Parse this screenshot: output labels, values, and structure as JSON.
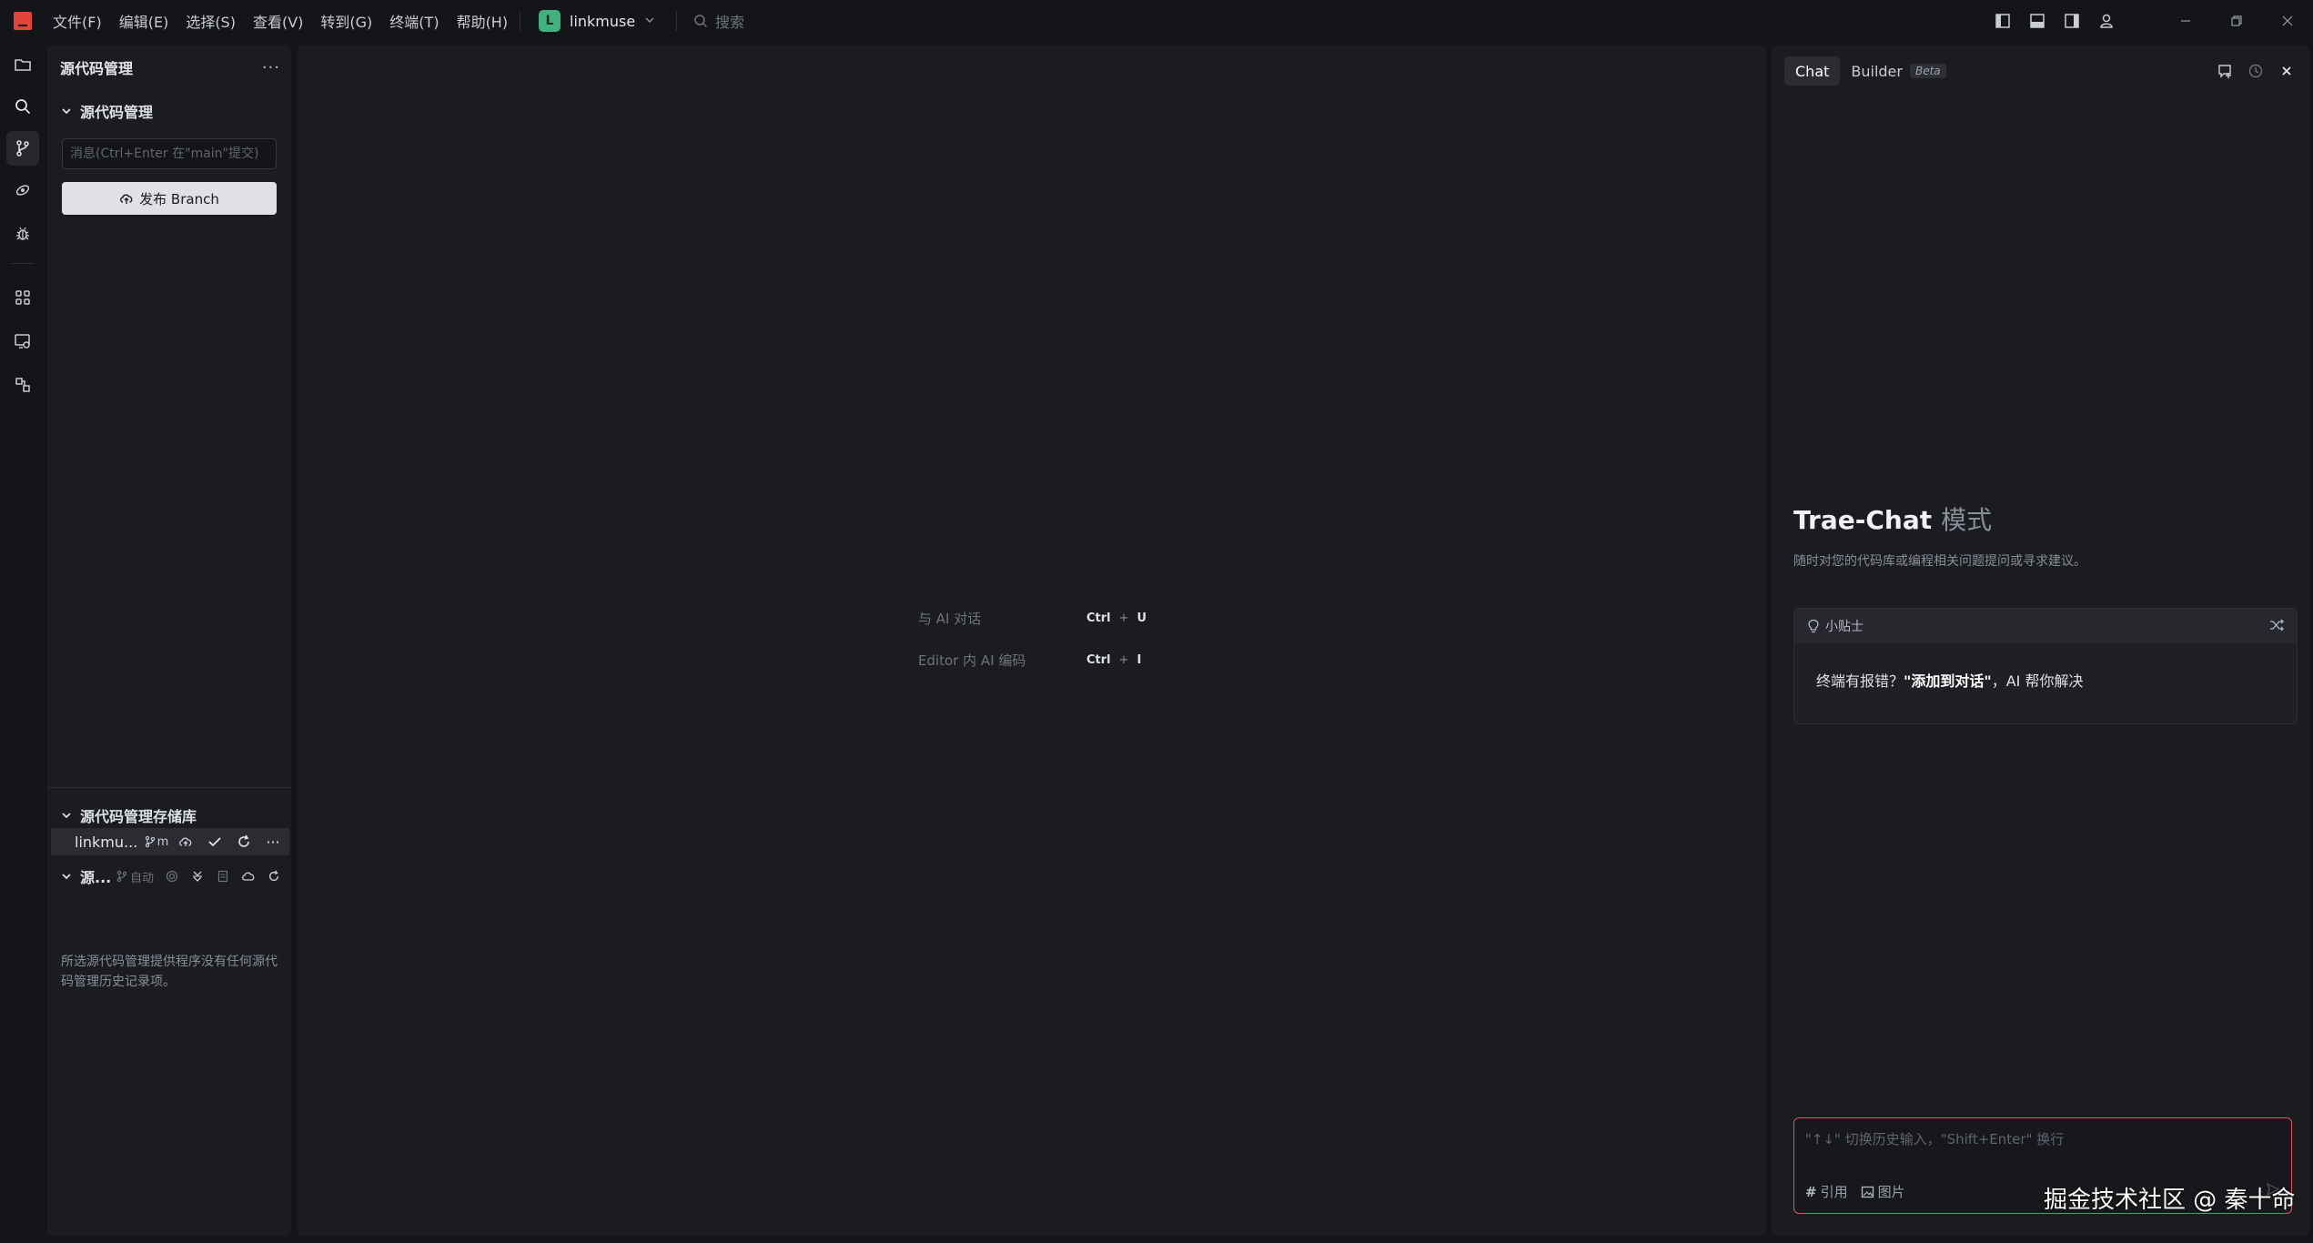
{
  "menu": {
    "items": [
      "文件(F)",
      "编辑(E)",
      "选择(S)",
      "查看(V)",
      "转到(G)",
      "终端(T)",
      "帮助(H)"
    ]
  },
  "project": {
    "initial": "L",
    "name": "linkmuse"
  },
  "search": {
    "placeholder": "搜索"
  },
  "sidebar": {
    "title": "源代码管理",
    "more": "···",
    "scm_section": "源代码管理",
    "commit_placeholder": "消息(Ctrl+Enter 在\"main\"提交)",
    "publish_label": "发布 Branch",
    "repos_section": "源代码管理存储库",
    "repo_name": "linkmu...",
    "repo_branch": "m",
    "graph_title": "源...",
    "graph_auto": "自动",
    "empty_message": "所选源代码管理提供程序没有任何源代码管理历史记录项。"
  },
  "editor": {
    "shortcuts": [
      {
        "label": "与 AI 对话",
        "mod": "Ctrl",
        "key": "U"
      },
      {
        "label": "Editor 内 AI 编码",
        "mod": "Ctrl",
        "key": "I"
      }
    ],
    "plus": "+"
  },
  "chat": {
    "tab_chat": "Chat",
    "tab_builder": "Builder",
    "beta": "Beta",
    "mode_title": "Trae-Chat",
    "mode_suffix": "模式",
    "mode_desc": "随时对您的代码库或编程相关问题提问或寻求建议。",
    "tip_label": "小贴士",
    "tip_prefix": "终端有报错？",
    "tip_highlight": "\"添加到对话\"",
    "tip_suffix": "，AI 帮你解决",
    "input_placeholder": "\"↑↓\" 切换历史输入，\"Shift+Enter\" 换行",
    "tool_ref": "引用",
    "tool_image": "图片"
  },
  "watermark": "掘金技术社区 @ 秦十命",
  "colors": {
    "background": "#141518",
    "panel": "#1b1c20",
    "accent_green": "#3fb27f",
    "logo_red": "#e8413a",
    "input_border": "#e05565"
  }
}
